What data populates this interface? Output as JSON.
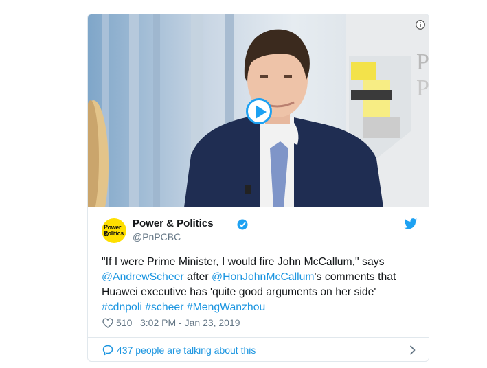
{
  "tweet": {
    "media": {
      "play_icon": "play-icon",
      "info_icon": "info-icon",
      "background_logo": "Po\nP"
    },
    "author": {
      "name": "Power & Politics",
      "handle": "@PnPCBC",
      "avatar_line1": "Power &",
      "avatar_line2": "Politics",
      "verified_icon": "verified-badge-icon",
      "brand_color": "#fedf00"
    },
    "text": {
      "part1": "\"If I were Prime Minister, I would fire John McCallum,\" says",
      "mention1": "@AndrewScheer",
      "part2": " after ",
      "mention2": "@HonJohnMcCallum",
      "part3": "'s comments that",
      "line3": "Huawei executive has 'quite good arguments on her side'",
      "hashtag1": "#cdnpoli",
      "hashtag2": "#scheer",
      "hashtag3": "#MengWanzhou"
    },
    "likes": "510",
    "timestamp": "3:02 PM - Jan 23, 2019",
    "footer": {
      "talking": "437 people are talking about this"
    },
    "colors": {
      "link": "#1b95e0",
      "twitter_blue": "#1da1f2",
      "muted": "#657786",
      "border": "#e1e8ed"
    }
  }
}
